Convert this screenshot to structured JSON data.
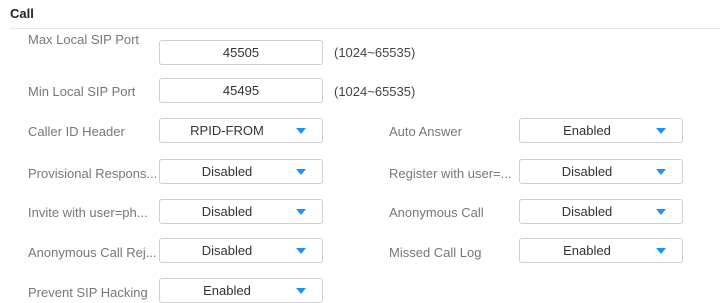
{
  "section": {
    "title": "Call"
  },
  "ports": [
    {
      "label": "Max Local SIP Port",
      "value": "45505",
      "range": "(1024~65535)"
    },
    {
      "label": "Min Local SIP Port",
      "value": "45495",
      "range": "(1024~65535)"
    }
  ],
  "left_selects": [
    {
      "label": "Caller ID Header",
      "value": "RPID-FROM"
    },
    {
      "label": "Provisional Respons...",
      "value": "Disabled"
    },
    {
      "label": "Invite with user=ph...",
      "value": "Disabled"
    },
    {
      "label": "Anonymous Call Rej...",
      "value": "Disabled"
    },
    {
      "label": "Prevent SIP Hacking",
      "value": "Enabled"
    }
  ],
  "right_selects": [
    {
      "label": "Auto Answer",
      "value": "Enabled"
    },
    {
      "label": "Register with user=...",
      "value": "Disabled"
    },
    {
      "label": "Anonymous Call",
      "value": "Disabled"
    },
    {
      "label": "Missed Call Log",
      "value": "Enabled"
    }
  ],
  "colors": {
    "caret": "#1e90ff",
    "border": "#cfcfcf",
    "divider": "#e6e6e6"
  },
  "icons": {
    "dropdown": "caret-down-icon"
  }
}
